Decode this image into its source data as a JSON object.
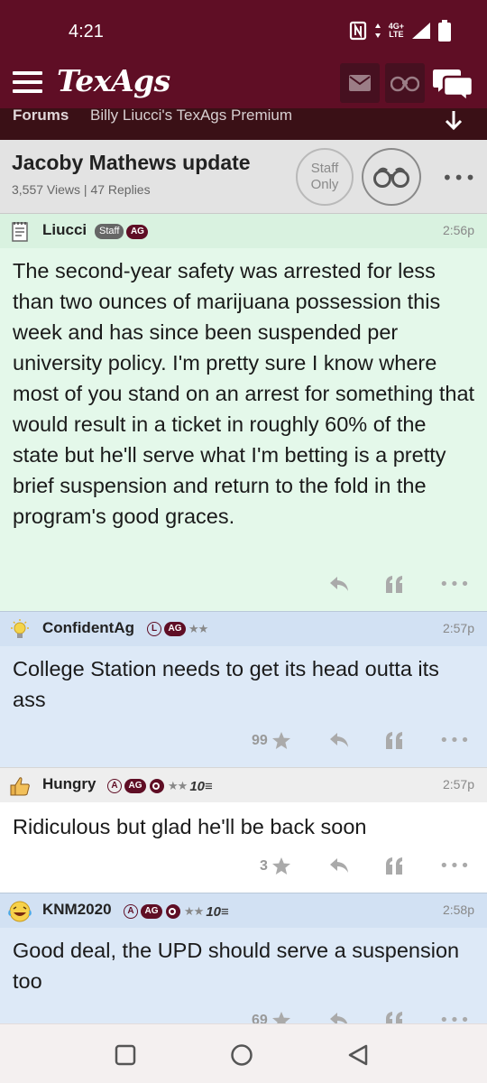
{
  "status_bar": {
    "time": "4:21",
    "network": [
      "4G+",
      "LTE"
    ]
  },
  "header": {
    "logo": "TexAgs",
    "colors": {
      "maroon": "#5f0e25",
      "dark_maroon": "#461020"
    }
  },
  "breadcrumb": {
    "section": "Forums",
    "forum": "Billy Liucci's TexAgs Premium"
  },
  "topic": {
    "title": "Jacoby Mathews update",
    "views": "3,557 Views",
    "separator": "|",
    "replies": "47 Replies",
    "staff_only": [
      "Staff",
      "Only"
    ]
  },
  "posts": [
    {
      "username": "Liucci",
      "avatar": "notepad-icon",
      "badges": {
        "staff": "Staff",
        "ag": "AG"
      },
      "time": "2:56p",
      "body": "The second-year safety was arrested for less than two ounces of marijuana possession this week and has since been suspended per university policy. I'm pretty sure I know where most of you stand on an arrest for something that would result in a ticket in roughly 60% of the state but he'll serve what I'm betting is a pretty brief suspension and return to the fold in the program's good graces.",
      "bg": "#e4f8ea"
    },
    {
      "username": "ConfidentAg",
      "avatar": "lightbulb-icon",
      "badges": {
        "letter": "L",
        "ag": "AG",
        "stars": "★★"
      },
      "time": "2:57p",
      "body": "College Station needs to get its head outta its ass",
      "likes": "99",
      "bg": "#dde9f7"
    },
    {
      "username": "Hungry",
      "avatar": "thumbs-up-icon",
      "badges": {
        "letter": "A",
        "ag": "AG",
        "stars": "★★",
        "ten": "10≡"
      },
      "time": "2:57p",
      "body": "Ridiculous but glad he'll be back soon",
      "likes": "3",
      "bg": "#ffffff"
    },
    {
      "username": "KNM2020",
      "avatar": "laughing-emoji-icon",
      "badges": {
        "letter": "A",
        "ag": "AG",
        "stars": "★★",
        "ten": "10≡"
      },
      "time": "2:58p",
      "body": "Good deal, the UPD should serve a suspension too",
      "likes": "69",
      "bg": "#dde9f7"
    }
  ]
}
